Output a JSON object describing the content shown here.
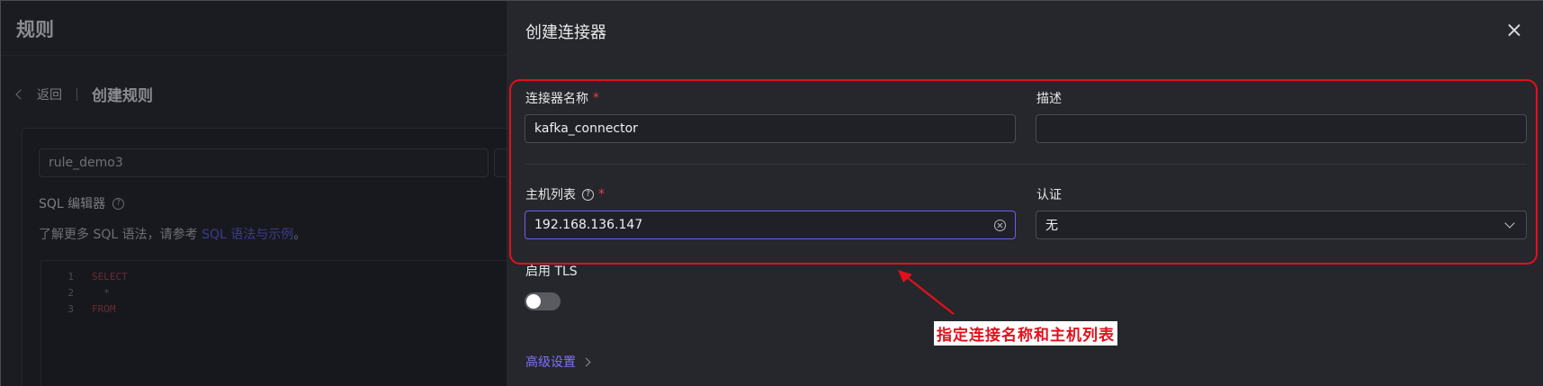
{
  "background": {
    "page_title": "规则",
    "back_label": "返回",
    "breadcrumb_current": "创建规则",
    "rule_name_value": "rule_demo3",
    "sql_editor_label": "SQL 编辑器",
    "sql_hint_prefix": "了解更多 SQL 语法，请参考 ",
    "sql_hint_link": "SQL 语法与示例",
    "sql_hint_suffix": "。",
    "editor_lines": [
      {
        "num": "1",
        "code": "SELECT"
      },
      {
        "num": "2",
        "code": "  *"
      },
      {
        "num": "3",
        "code": "FROM"
      }
    ]
  },
  "drawer": {
    "title": "创建连接器",
    "close_icon": "close-icon",
    "connector_name": {
      "label": "连接器名称",
      "required_mark": "*",
      "value": "kafka_connector"
    },
    "description": {
      "label": "描述",
      "value": ""
    },
    "host_list": {
      "label": "主机列表",
      "help_glyph": "?",
      "required_mark": "*",
      "value": "192.168.136.147"
    },
    "auth": {
      "label": "认证",
      "selected": "无"
    },
    "tls": {
      "label": "启用 TLS",
      "enabled": false
    },
    "advanced_link": "高级设置"
  },
  "annotation": {
    "text": "指定连接名称和主机列表",
    "color": "#e3101c"
  },
  "colors": {
    "accent": "#6b5ef0",
    "link": "#7e72f5",
    "required": "#ef3a4b",
    "drawer_bg": "#26272c",
    "overlay_bg": "#1b1c21"
  }
}
